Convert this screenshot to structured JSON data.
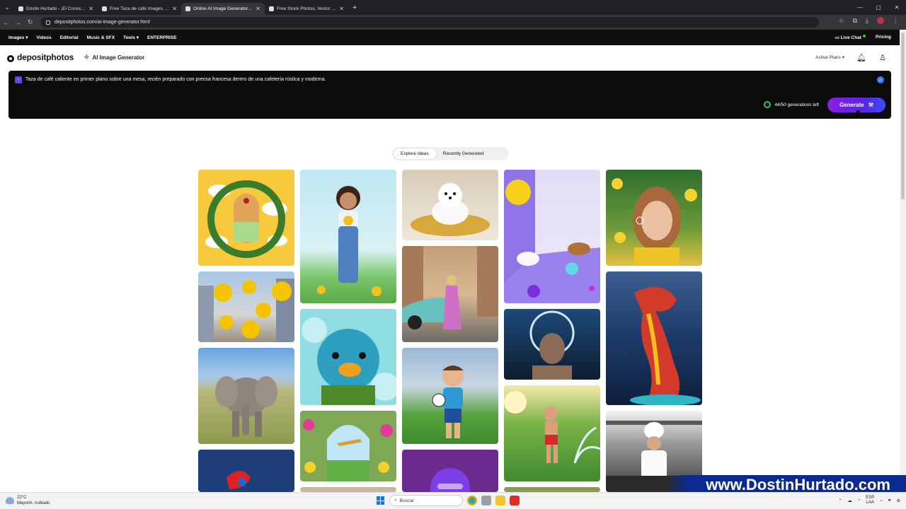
{
  "browser": {
    "tabs": [
      {
        "label": "Dostin Hurtado - ¡El Conocimiento",
        "active": false
      },
      {
        "label": "Free Taza de cafe Images & Vid",
        "active": false
      },
      {
        "label": "Online AI Image Generator by D",
        "active": true
      },
      {
        "label": "Free Stock Photos, Vector Imag",
        "active": false
      }
    ],
    "url": "depositphotos.com/ai-image-generator.html"
  },
  "site_nav": {
    "items": [
      "Images ▾",
      "Videos",
      "Editorial",
      "Music & SFX",
      "Tools ▾",
      "ENTERPRISE"
    ],
    "live_chat": "Live Chat",
    "pricing": "Pricing"
  },
  "header": {
    "logo": "depositphotos",
    "ai_label": "AI Image Generator",
    "active_plans": "Active Plans ▾"
  },
  "prompt": {
    "text": "Taza de café caliente en primer plano sobre una mesa, recién preparado con prensa francesa dentro de una cafetería rústica y moderna.",
    "generations_left": "44/50 generations left",
    "generate_label": "Generate"
  },
  "toggle": {
    "explore": "Explore Ideas",
    "recent": "Recently Generated"
  },
  "watermark": "www.DostinHurtado.com",
  "taskbar": {
    "temp": "22°C",
    "weather": "Mayorm. nublado",
    "search": "Buscar",
    "lang1": "ESP",
    "lang2": "LAA"
  },
  "colors": {
    "accent": "#5a22e8",
    "prompt_bg": "#0b0b0b",
    "progress_ring": "#3cc35a"
  }
}
